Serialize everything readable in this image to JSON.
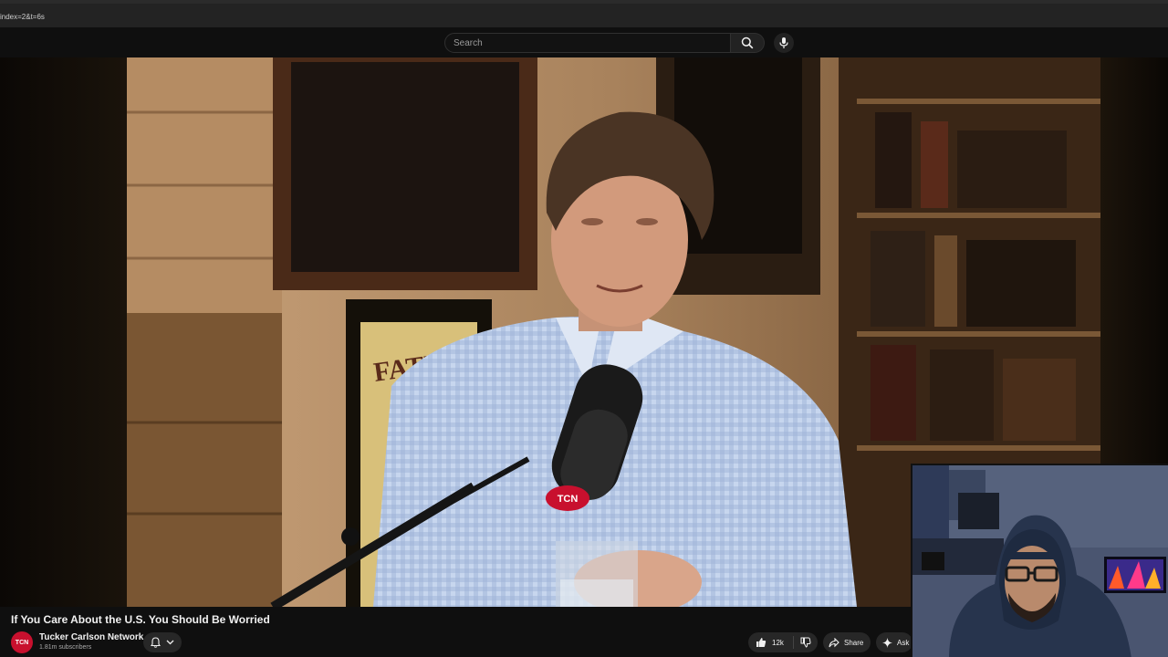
{
  "browser": {
    "url": "index=2&t=6s"
  },
  "search": {
    "placeholder": "Search"
  },
  "icons": {
    "search": "search-icon",
    "mic": "microphone-icon",
    "bell": "bell-icon",
    "chevron": "chevron-down-icon",
    "like": "thumbs-up-icon",
    "dislike": "thumbs-down-icon",
    "share": "share-icon",
    "ask": "sparkle-icon"
  },
  "video": {
    "title": "If You Care About the U.S. You Should Be Worried",
    "mic_logo": "TCN",
    "poster_text": "FATIMA"
  },
  "channel": {
    "name": "Tucker Carlson Network",
    "subscribers": "1.81m subscribers",
    "avatar_text": "TCN"
  },
  "actions": {
    "likes": "12k",
    "share": "Share",
    "ask": "Ask"
  },
  "colors": {
    "accent": "#c8102e",
    "background": "#0f0f0f"
  }
}
